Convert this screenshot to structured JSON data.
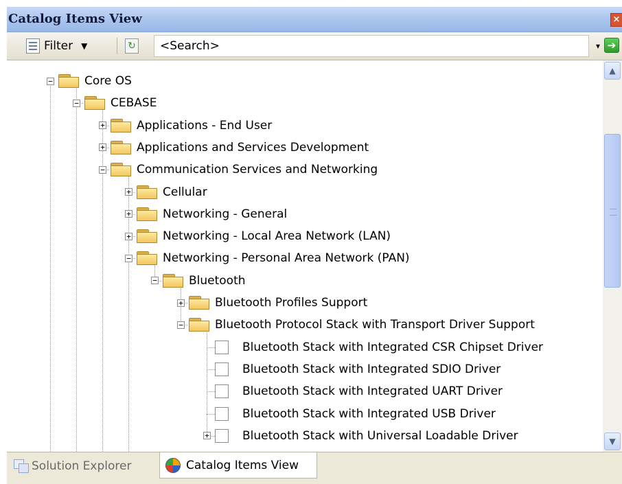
{
  "window": {
    "title": "Catalog Items View",
    "close_glyph": "×"
  },
  "toolbar": {
    "filter_label": "Filter",
    "filter_icon": "filter-list-icon",
    "refresh_icon": "refresh-icon",
    "search_value": "<Search>",
    "search_dropdown_glyph": "▾",
    "go_glyph": "➔"
  },
  "tree": {
    "expanded_glyph": "−",
    "collapsed_glyph": "+",
    "nodes": [
      {
        "label": "Core OS",
        "depth": 0,
        "kind": "folder",
        "state": "expanded"
      },
      {
        "label": "CEBASE",
        "depth": 1,
        "kind": "folder",
        "state": "expanded"
      },
      {
        "label": "Applications - End User",
        "depth": 2,
        "kind": "folder",
        "state": "collapsed"
      },
      {
        "label": "Applications and Services Development",
        "depth": 2,
        "kind": "folder",
        "state": "collapsed"
      },
      {
        "label": "Communication Services and Networking",
        "depth": 2,
        "kind": "folder",
        "state": "expanded"
      },
      {
        "label": "Cellular",
        "depth": 3,
        "kind": "folder",
        "state": "collapsed"
      },
      {
        "label": "Networking - General",
        "depth": 3,
        "kind": "folder",
        "state": "collapsed"
      },
      {
        "label": "Networking - Local Area Network (LAN)",
        "depth": 3,
        "kind": "folder",
        "state": "collapsed"
      },
      {
        "label": "Networking - Personal Area Network (PAN)",
        "depth": 3,
        "kind": "folder",
        "state": "expanded"
      },
      {
        "label": "Bluetooth",
        "depth": 4,
        "kind": "folder",
        "state": "expanded"
      },
      {
        "label": "Bluetooth Profiles Support",
        "depth": 5,
        "kind": "folder",
        "state": "collapsed"
      },
      {
        "label": "Bluetooth Protocol Stack with Transport Driver Support",
        "depth": 5,
        "kind": "folder",
        "state": "expanded"
      },
      {
        "label": "Bluetooth Stack with Integrated CSR Chipset Driver",
        "depth": 6,
        "kind": "item",
        "state": "leaf"
      },
      {
        "label": "Bluetooth Stack with Integrated SDIO Driver",
        "depth": 6,
        "kind": "item",
        "state": "leaf"
      },
      {
        "label": "Bluetooth Stack with Integrated UART Driver",
        "depth": 6,
        "kind": "item",
        "state": "leaf"
      },
      {
        "label": "Bluetooth Stack with Integrated USB Driver",
        "depth": 6,
        "kind": "item",
        "state": "leaf"
      },
      {
        "label": "Bluetooth Stack with Universal Loadable Driver",
        "depth": 6,
        "kind": "item",
        "state": "collapsed"
      }
    ]
  },
  "scrollbar": {
    "up_glyph": "▲",
    "down_glyph": "▼",
    "thumb_position_fraction": 0.15,
    "thumb_size_fraction": 0.44
  },
  "tabs": [
    {
      "label": "Solution Explorer",
      "active": false,
      "icon": "solution-explorer-icon"
    },
    {
      "label": "Catalog Items View",
      "active": true,
      "icon": "catalog-icon"
    }
  ]
}
